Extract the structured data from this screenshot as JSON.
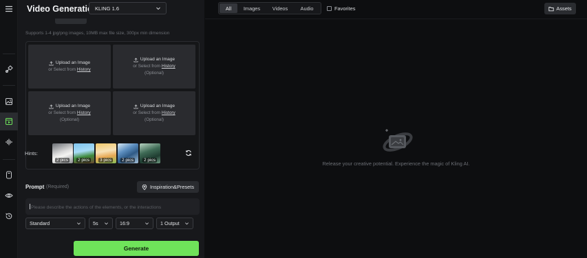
{
  "header": {
    "title": "Video Generation",
    "model": "KLING 1.6"
  },
  "upload": {
    "support_text": "Supports 1-4 jpg/png images, 10MB max file size, 300px min dimension",
    "cells": [
      {
        "title": "Upload an Image",
        "sub_prefix": "or Select from",
        "link": "History",
        "optional": ""
      },
      {
        "title": "Upload an Image",
        "sub_prefix": "or Select from",
        "link": "History",
        "optional": "(Optional)"
      },
      {
        "title": "Upload an Image",
        "sub_prefix": "or Select from",
        "link": "History",
        "optional": "(Optional)"
      },
      {
        "title": "Upload an Image",
        "sub_prefix": "or Select from",
        "link": "History",
        "optional": "(Optional)"
      }
    ],
    "hints_label": "Hints:",
    "hints": [
      {
        "badge": "2 pics"
      },
      {
        "badge": "2 pics"
      },
      {
        "badge": "3 pics"
      },
      {
        "badge": "2 pics"
      },
      {
        "badge": "2 pics"
      }
    ]
  },
  "prompt": {
    "label": "Prompt",
    "required": "(Required)",
    "inspiration_button": "Inspiration&Presets",
    "placeholder": "Please describe the actions of the elements, or the interactions"
  },
  "options": {
    "mode": "Standard",
    "duration": "5s",
    "ratio": "16:9",
    "outputs": "1 Output"
  },
  "generate_label": "Generate",
  "topbar": {
    "tabs": [
      "All",
      "Images",
      "Videos",
      "Audio"
    ],
    "favorites": "Favorites",
    "assets": "Assets"
  },
  "empty_state": "Release your creative potential. Experience the magic of Kling AI.",
  "colors": {
    "accent": "#6fe35a",
    "panel": "#17181b",
    "background": "#0d0e10"
  }
}
